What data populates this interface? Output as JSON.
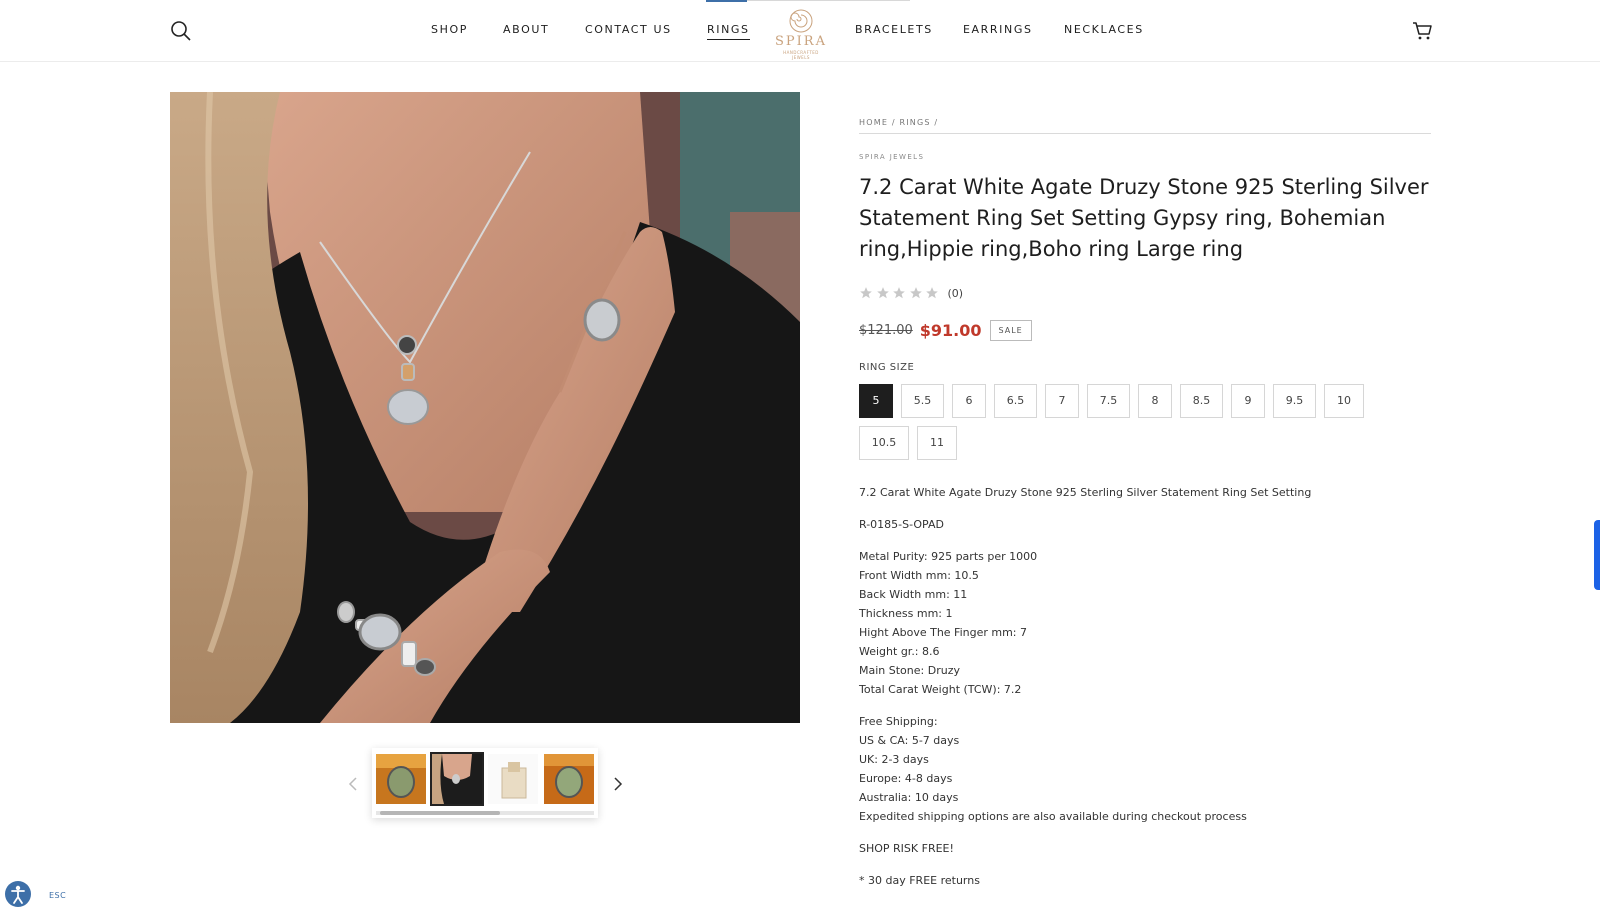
{
  "header": {
    "nav": [
      {
        "label": "SHOP"
      },
      {
        "label": "ABOUT"
      },
      {
        "label": "CONTACT US"
      },
      {
        "label": "RINGS"
      },
      {
        "label": "BRACELETS"
      },
      {
        "label": "EARRINGS"
      },
      {
        "label": "NECKLACES"
      }
    ],
    "active_nav": "RINGS",
    "logo_text": "SPIRA",
    "logo_subtext": "HANDCRAFTED JEWELS"
  },
  "breadcrumb": {
    "home": "HOME",
    "separator": "/",
    "category": "RINGS"
  },
  "product": {
    "vendor": "SPIRA JEWELS",
    "title": "7.2 Carat White Agate Druzy Stone 925 Sterling Silver Statement Ring Set Setting Gypsy ring, Bohemian ring,Hippie ring,Boho ring Large ring",
    "rating": 0,
    "rating_count": "(0)",
    "price_old": "$121.00",
    "price_new": "$91.00",
    "sale_badge": "SALE",
    "size_label": "RING SIZE",
    "sizes": [
      "5",
      "5.5",
      "6",
      "6.5",
      "7",
      "7.5",
      "8",
      "8.5",
      "9",
      "9.5",
      "10",
      "10.5",
      "11"
    ],
    "selected_size": "5"
  },
  "description": {
    "summary": "7.2 Carat White Agate Druzy Stone 925 Sterling Silver Statement Ring Set Setting",
    "sku": "R-0185-S-OPAD",
    "specs": [
      "Metal Purity: 925 parts per 1000",
      "Front Width mm: 10.5",
      "Back Width mm: 11",
      "Thickness mm: 1",
      "Hight Above The Finger mm: 7",
      "Weight gr.: 8.6",
      "Main Stone: Druzy",
      "Total Carat Weight (TCW): 7.2"
    ],
    "shipping": [
      "Free Shipping:",
      "US & CA: 5-7 days",
      "UK: 2-3 days",
      "Europe: 4-8 days",
      "Australia: 10 days",
      "Expedited shipping options are also available during checkout process"
    ],
    "shop_risk": "SHOP RISK FREE!",
    "returns": "* 30 day FREE returns"
  },
  "gallery": {
    "thumbnails": [
      "druzy-ring-on-orange",
      "model-wearing-set",
      "jewelry-gift-box",
      "druzy-ring-on-orange-2"
    ],
    "selected_index": 1
  },
  "accessibility": {
    "esc_label": "ESC"
  },
  "colors": {
    "accent": "#3d6fa8",
    "sale": "#c0392b",
    "brand": "#c9a27d",
    "side_tab": "#1c62e6"
  }
}
